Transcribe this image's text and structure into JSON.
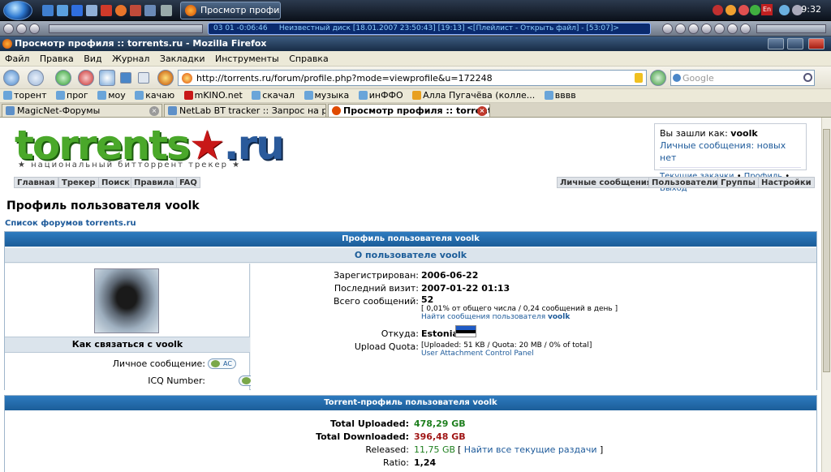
{
  "taskbar": {
    "window_button": "Просмотр профил...",
    "clock": "9:32",
    "language": "En"
  },
  "player": {
    "display_time": "03   01   -0:06:46",
    "display_text": "Неизвестный диск [18.01.2007 23:50:43] [19:13]   <[Плейлист - Открыть файл] - [53:07]>"
  },
  "window": {
    "title": "Просмотр профиля :: torrents.ru - Mozilla Firefox"
  },
  "menu": {
    "items": [
      "Файл",
      "Правка",
      "Вид",
      "Журнал",
      "Закладки",
      "Инструменты",
      "Справка"
    ]
  },
  "nav": {
    "url": "http://torrents.ru/forum/profile.php?mode=viewprofile&u=172248",
    "search_placeholder": "Google"
  },
  "bookmarks": [
    "торент",
    "прог",
    "моу",
    "качаю",
    "mKINO.net",
    "скачал",
    "музыка",
    "инФФО",
    "Алла Пугачёва (колле...",
    "вввв"
  ],
  "tabs": [
    {
      "label": "MagicNet-Форумы"
    },
    {
      "label": "NetLab BT tracker :: Запрос на регис..."
    },
    {
      "label": "Просмотр профиля :: torrents.ru"
    }
  ],
  "site": {
    "logo_main": "torrents",
    "logo_star": "★",
    "logo_ru": ".ru",
    "tagline": "★ национальный битторрент трекер ★",
    "login_label": "Вы зашли как:",
    "login_user": "voolk",
    "pm_link": "Личные сообщения: новых нет",
    "current_downloads": "Текущие закачки",
    "profile_link": "Профиль",
    "logout_link": "Выход",
    "nav_left": [
      "Главная",
      "Трекер",
      "Поиск",
      "Правила",
      "FAQ"
    ],
    "nav_right": [
      "Личные сообщения",
      "Пользователи",
      "Группы",
      "Настройки"
    ]
  },
  "profile": {
    "page_title": "Профиль пользователя voolk",
    "breadcrumb": "Список форумов torrents.ru",
    "header": "Профиль пользователя voolk",
    "about_header": "О пользователе voolk",
    "contact_header": "Как связаться с voolk",
    "pm_label": "Личное сообщение:",
    "pm_button": "AC",
    "icq_label": "ICQ Number:",
    "icq_button": "ICQ",
    "registered_label": "Зарегистрирован:",
    "registered_value": "2006-06-22",
    "last_visit_label": "Последний визит:",
    "last_visit_value": "2007-01-22 01:13",
    "posts_label": "Всего сообщений:",
    "posts_value": "52",
    "posts_detail": "[ 0,01% от общего числа / 0,24 сообщений в день ]",
    "posts_link_prefix": "Найти сообщения пользователя",
    "posts_link_user": "voolk",
    "from_label": "Откуда:",
    "from_value": "Estonia",
    "quota_label": "Upload Quota:",
    "quota_value": "[Uploaded: 51 KB / Quota: 20 MB / 0% of total]",
    "quota_link": "User Attachment Control Panel"
  },
  "torrent": {
    "header": "Torrent-профиль пользователя voolk",
    "uploaded_label": "Total Uploaded:",
    "uploaded_value": "478,29 GB",
    "downloaded_label": "Total Downloaded:",
    "downloaded_value": "396,48 GB",
    "released_label": "Released:",
    "released_value": "11,75 GB",
    "released_link": "Найти все текущие раздачи",
    "ratio_label": "Ratio:",
    "ratio_value": "1,24"
  }
}
